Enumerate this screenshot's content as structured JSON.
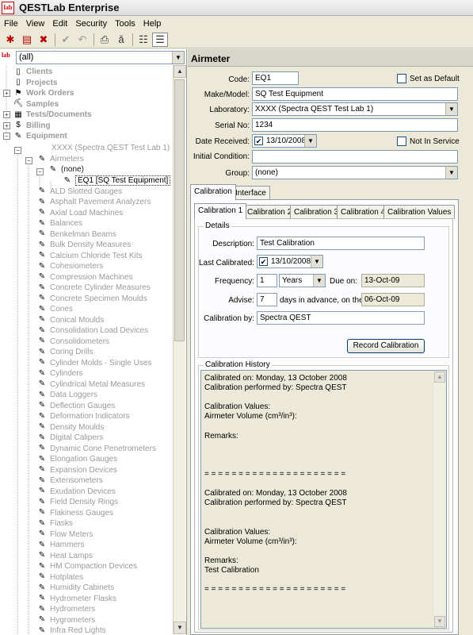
{
  "app": {
    "title": "QESTLab Enterprise",
    "logo_text": "lab"
  },
  "menu": [
    "File",
    "View",
    "Edit",
    "Security",
    "Tools",
    "Help"
  ],
  "toolbar_icons": [
    "new-record-icon",
    "properties-icon",
    "delete-icon",
    "check-icon",
    "undo-icon",
    "print-icon",
    "spell-check-icon",
    "tree-view-icon",
    "list-view-icon"
  ],
  "filter": {
    "value": "(all)",
    "logo_text": "lab"
  },
  "tree": {
    "top": [
      "Clients",
      "Projects",
      "Work Orders",
      "Samples",
      "Tests/Documents",
      "Billing",
      "Equipment"
    ],
    "lab": "XXXX (Spectra QEST Test Lab 1)",
    "airmeters": "Airmeters",
    "none": "(none)",
    "selected": "EQ1 [SQ Test Equipment]",
    "types": [
      "ALD Slotted Gauges",
      "Asphalt Pavement Analyzers",
      "Axial Load Machines",
      "Balances",
      "Benkelman Beams",
      "Bulk Density Measures",
      "Calcium Chloride Test Kits",
      "Cohesiometers",
      "Compression Machines",
      "Concrete Cylinder Measures",
      "Concrete Specimen Moulds",
      "Cones",
      "Conical Moulds",
      "Consolidation Load Devices",
      "Consolidometers",
      "Coring Drills",
      "Cylinder Molds - Single Uses",
      "Cylinders",
      "Cylindrical Metal Measures",
      "Data Loggers",
      "Deflection Gauges",
      "Deformation Indicators",
      "Density Moulds",
      "Digital Calipers",
      "Dynamic Cone Penetrometers",
      "Elongation Gauges",
      "Expansion Devices",
      "Extensometers",
      "Exudation Devices",
      "Field Density Rings",
      "Flakiness Gauges",
      "Flasks",
      "Flow Meters",
      "Hammers",
      "Heat Lamps",
      "HM Compaction Devices",
      "Hotplates",
      "Humidity Cabinets",
      "Hydrometer Flasks",
      "Hydrometers",
      "Hygrometers",
      "Infra Red Lights"
    ]
  },
  "detail": {
    "header": "Airmeter",
    "code_label": "Code:",
    "code": "EQ1",
    "set_default": "Set as Default",
    "make_label": "Make/Model:",
    "make": "SQ Test Equipment",
    "lab_label": "Laboratory:",
    "lab": "XXXX (Spectra QEST Test Lab 1)",
    "serial_label": "Serial No:",
    "serial": "1234",
    "date_label": "Date Received:",
    "date": "13/10/2008",
    "not_in_service": "Not In Service",
    "cond_label": "Initial Condition:",
    "cond": "",
    "group_label": "Group:",
    "group": "(none)"
  },
  "outer_tabs": [
    "Calibration",
    "Interface"
  ],
  "inner_tabs": [
    "Calibration 1",
    "Calibration 2",
    "Calibration 3",
    "Calibration 4",
    "Calibration Values"
  ],
  "calibration": {
    "details_title": "Details",
    "desc_label": "Description:",
    "desc": "Test Calibration",
    "last_label": "Last Calibrated:",
    "last": "13/10/2008",
    "freq_label": "Frequency:",
    "freq": "1",
    "freq_unit": "Years",
    "due_label": "Due on:",
    "due": "13-Oct-09",
    "advise_label": "Advise:",
    "advise": "7",
    "advise_text": "days in advance, on the",
    "advise_date": "06-Oct-09",
    "by_label": "Calibration by:",
    "by": "Spectra QEST",
    "record_button": "Record Calibration"
  },
  "history": {
    "title": "Calibration History",
    "lines": [
      "Calibrated on: Monday, 13 October 2008",
      "Calibration performed by: Spectra QEST",
      "",
      "Calibration Values:",
      "Airmeter Volume (cm³/in³):",
      "",
      "Remarks:",
      "",
      "",
      "",
      "= = = = = = = = = = = = = = = = = = = = =",
      "",
      "Calibrated on: Monday, 13 October 2008",
      "Calibration performed by: Spectra QEST",
      "",
      "",
      "Calibration Values:",
      "Airmeter Volume (cm³/in³):",
      "",
      "Remarks:",
      "Test Calibration",
      "",
      "= = = = = = = = = = = = = = = = = = = = ="
    ]
  }
}
